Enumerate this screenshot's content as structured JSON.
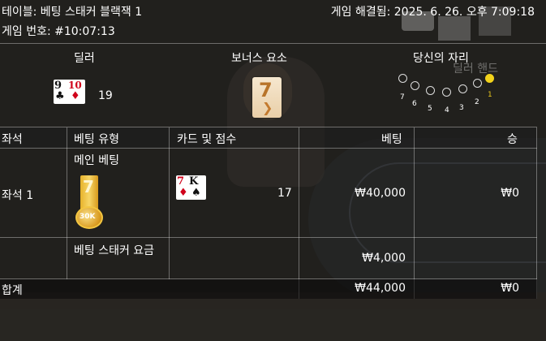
{
  "header": {
    "table_label": "테이블: 베팅 스태커 블랙잭 1",
    "game_resolved": "게임 해결됨: 2025. 6. 26. 오후 7:09:18",
    "game_number": "게임 번호: #10:07:13"
  },
  "columns": {
    "dealer": "딜러",
    "bonus": "보너스 요소",
    "your_seat": "당신의 자리",
    "dealer_hand_ghost": "딜러 핸드"
  },
  "dealer": {
    "cards": [
      {
        "rank": "9",
        "suit": "♣",
        "color": "#111111"
      },
      {
        "rank": "10",
        "suit": "♦",
        "color": "#d0021b"
      }
    ],
    "score": "19"
  },
  "bonus_card": {
    "rank": "7",
    "suit": "spade-orange-icon"
  },
  "seats": {
    "labels": [
      "7",
      "6",
      "5",
      "4",
      "3",
      "2",
      "1"
    ],
    "active_seat": "1",
    "active_color": "#f2d21b"
  },
  "bets_table": {
    "headers": {
      "seat": "좌석",
      "bet_type": "베팅 유형",
      "cards_score": "카드 및 점수",
      "bet": "베팅",
      "win": "승"
    },
    "rows": [
      {
        "seat": "좌석 1",
        "bet_type": "메인 베팅",
        "badge": {
          "rank": "7",
          "chip": "30K"
        },
        "cards": [
          {
            "rank": "7",
            "suit": "♦",
            "color": "#d0021b"
          },
          {
            "rank": "K",
            "suit": "♠",
            "color": "#111111"
          }
        ],
        "score": "17",
        "bet": "₩40,000",
        "win": "₩0"
      },
      {
        "seat": "",
        "bet_type": "베팅 스태커 요금",
        "bet": "₩4,000",
        "win": ""
      }
    ],
    "total": {
      "label": "합계",
      "bet": "₩44,000",
      "win": "₩0"
    }
  }
}
